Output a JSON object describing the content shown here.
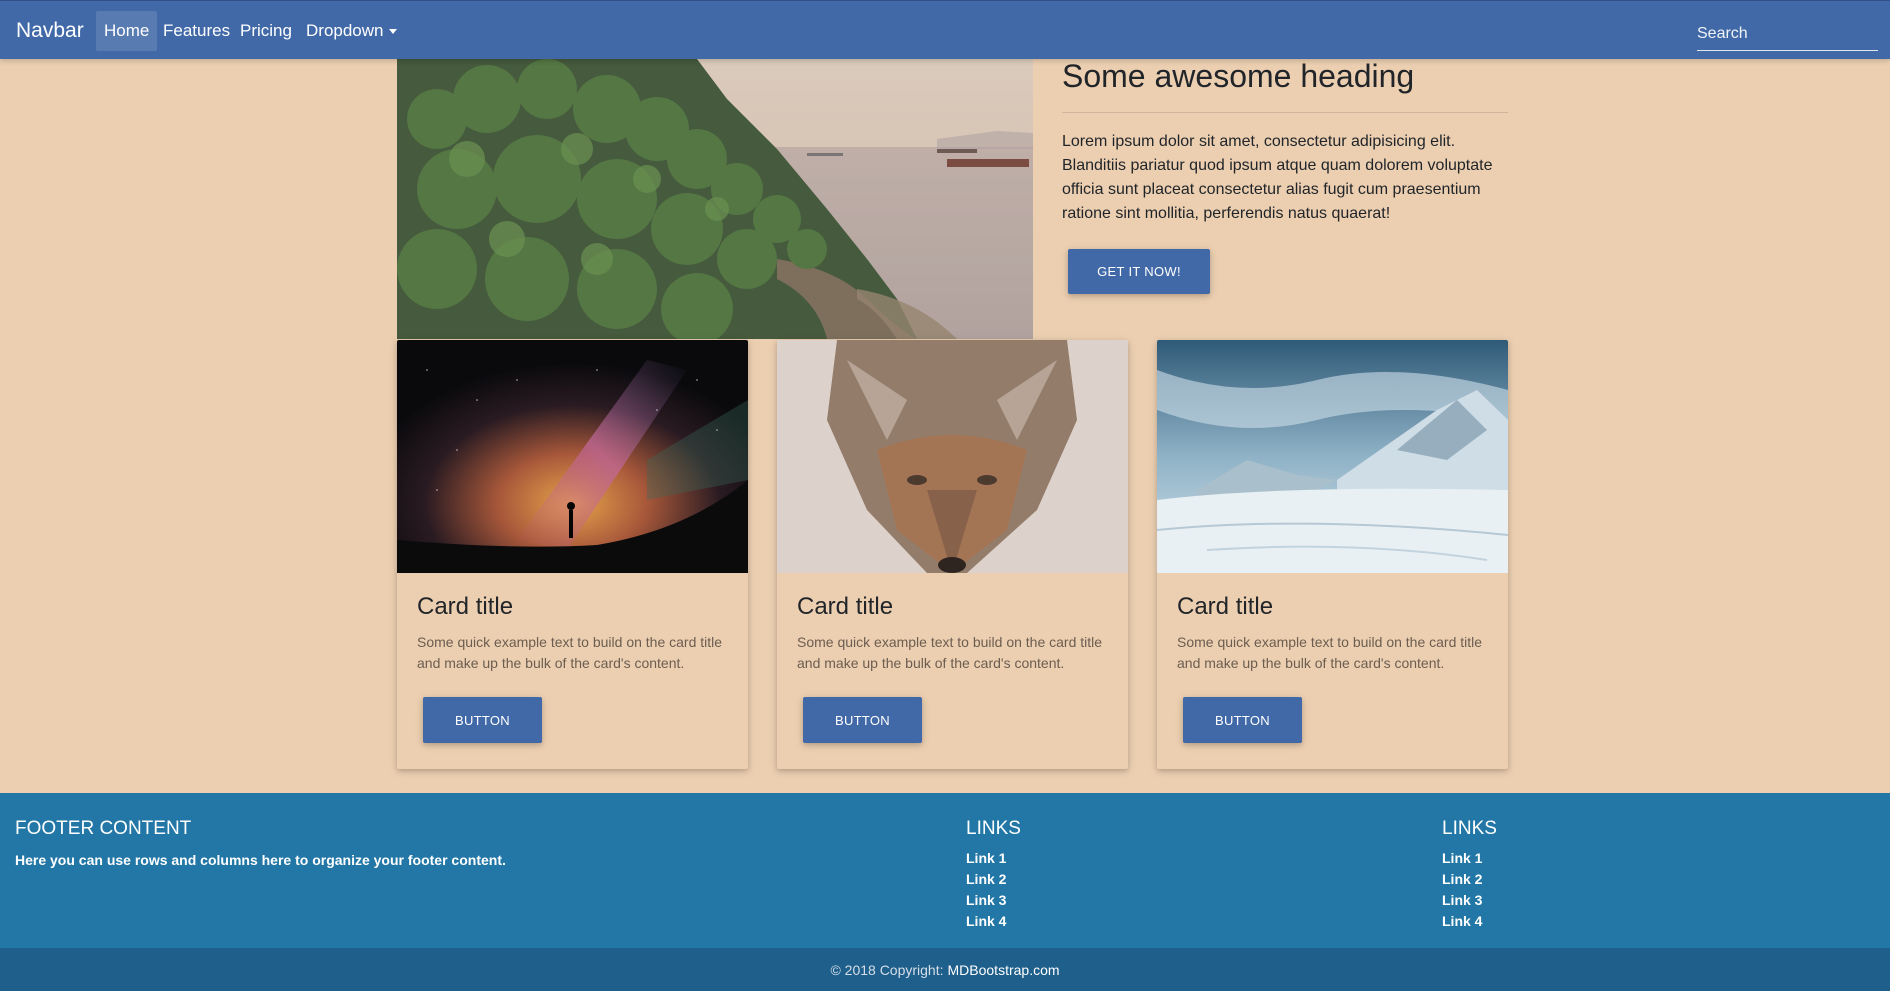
{
  "navbar": {
    "brand": "Navbar",
    "items": [
      {
        "label": "Home",
        "active": true
      },
      {
        "label": "Features"
      },
      {
        "label": "Pricing"
      },
      {
        "label": "Dropdown"
      }
    ],
    "search_placeholder": "Search"
  },
  "hero": {
    "image": "forest-coastline-photo",
    "heading": "Some awesome heading",
    "text": "Lorem ipsum dolor sit amet, consectetur adipisicing elit. Blanditiis pariatur quod ipsum atque quam dolorem voluptate officia sunt placeat consectetur alias fugit cum praesentium ratione sint mollitia, perferendis natus quaerat!",
    "button": "GET IT NOW!"
  },
  "cards": [
    {
      "image": "milky-way-night-sky-photo",
      "title": "Card title",
      "text": "Some quick example text to build on the card title and make up the bulk of the card's content.",
      "button": "BUTTON"
    },
    {
      "image": "coyote-photo",
      "title": "Card title",
      "text": "Some quick example text to build on the card title and make up the bulk of the card's content.",
      "button": "BUTTON"
    },
    {
      "image": "snowy-mountain-photo",
      "title": "Card title",
      "text": "Some quick example text to build on the card title and make up the bulk of the card's content.",
      "button": "BUTTON"
    }
  ],
  "footer": {
    "content_heading": "FOOTER CONTENT",
    "content_text": "Here you can use rows and columns here to organize your footer content.",
    "links_col1": {
      "heading": "LINKS",
      "links": [
        "Link 1",
        "Link 2",
        "Link 3",
        "Link 4"
      ]
    },
    "links_col2": {
      "heading": "LINKS",
      "links": [
        "Link 1",
        "Link 2",
        "Link 3",
        "Link 4"
      ]
    },
    "copyright_prefix": "© 2018 Copyright:",
    "copyright_link": "MDBootstrap.com"
  },
  "colors": {
    "primary": "#4169a8",
    "background": "#eccfb1",
    "footer": "#2277a6",
    "footer_copyright": "#1e5f8b"
  }
}
